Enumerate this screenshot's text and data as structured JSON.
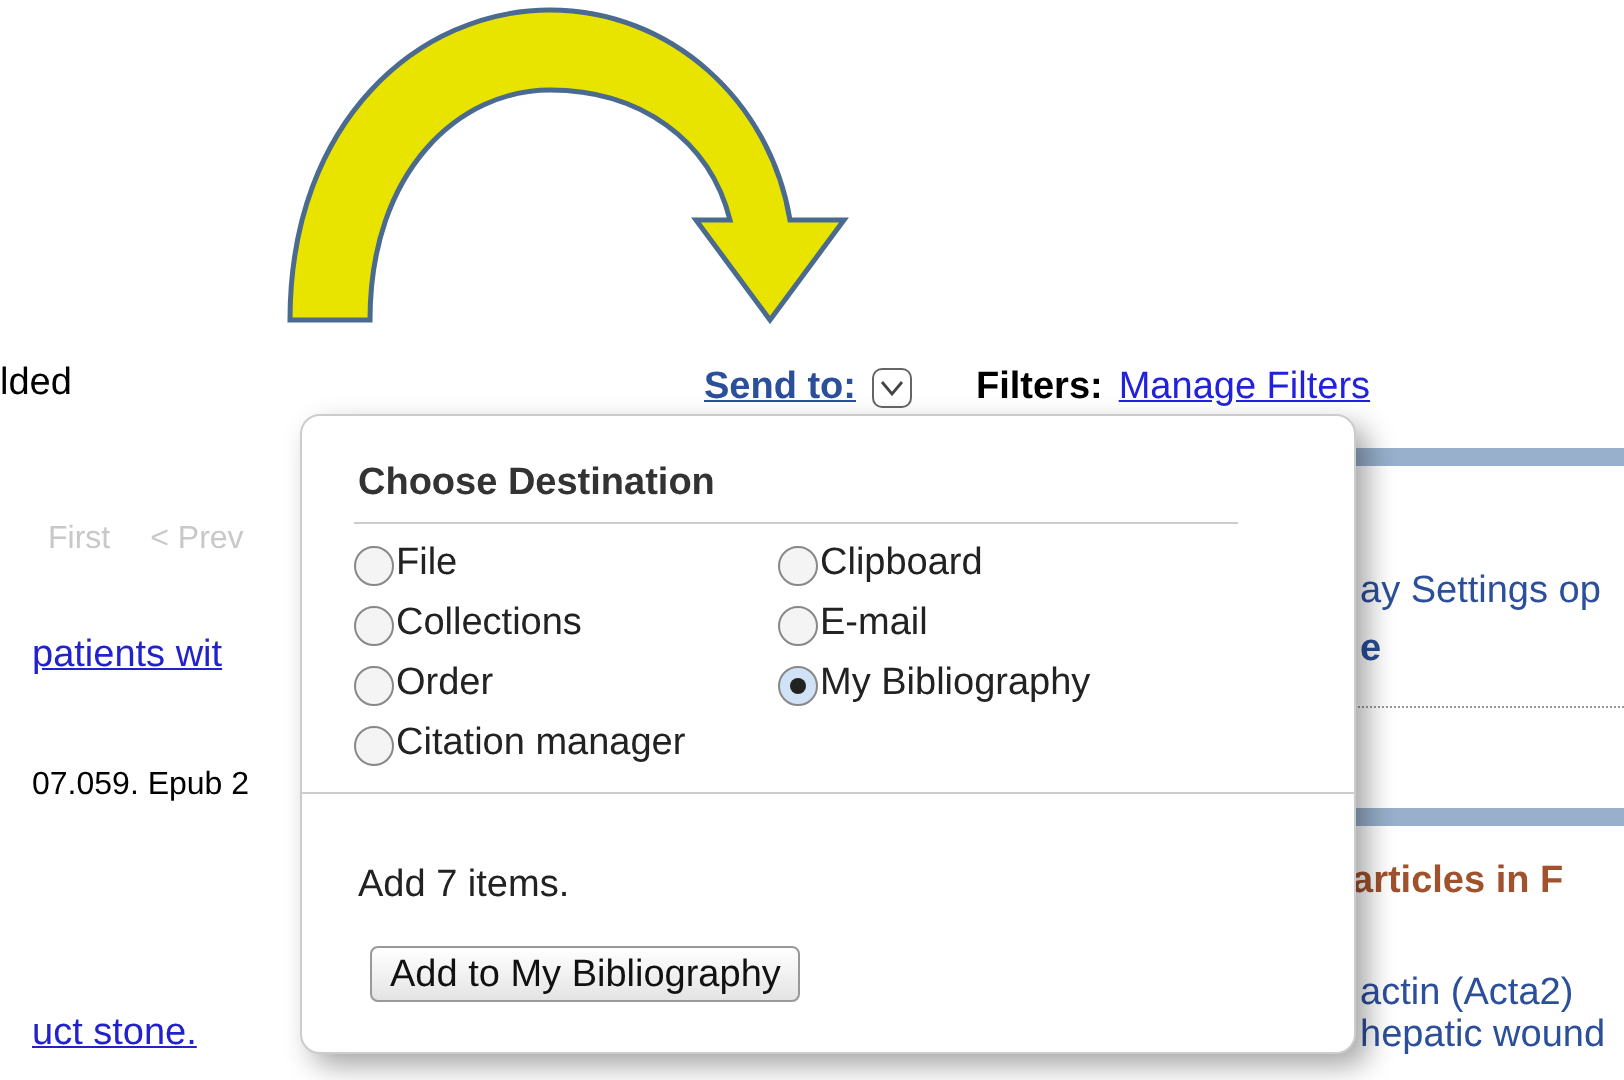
{
  "results": {
    "count_text": "lded",
    "pager": [
      {
        "label": "First"
      },
      {
        "label": "< Prev"
      }
    ],
    "title_link": "patients wit",
    "citation": "07.059. Epub 2",
    "title_link_2": "uct stone."
  },
  "toolbar": {
    "send_to": "Send to:",
    "filters_label": "Filters:",
    "filters_link": "Manage Filters"
  },
  "sidebar": {
    "settings_text": "ay Settings op",
    "settings_text_2": "e",
    "related_heading": "articles in F",
    "related_line_1": "actin (Acta2)",
    "related_line_2": "hepatic wound"
  },
  "popup": {
    "title": "Choose Destination",
    "options": [
      {
        "label": "File",
        "selected": false
      },
      {
        "label": "Clipboard",
        "selected": false
      },
      {
        "label": "Collections",
        "selected": false
      },
      {
        "label": "E-mail",
        "selected": false
      },
      {
        "label": "Order",
        "selected": false
      },
      {
        "label": "My Bibliography",
        "selected": true
      },
      {
        "label": "Citation manager",
        "selected": false
      }
    ],
    "summary": "Add 7 items.",
    "action": "Add to My Bibliography"
  }
}
